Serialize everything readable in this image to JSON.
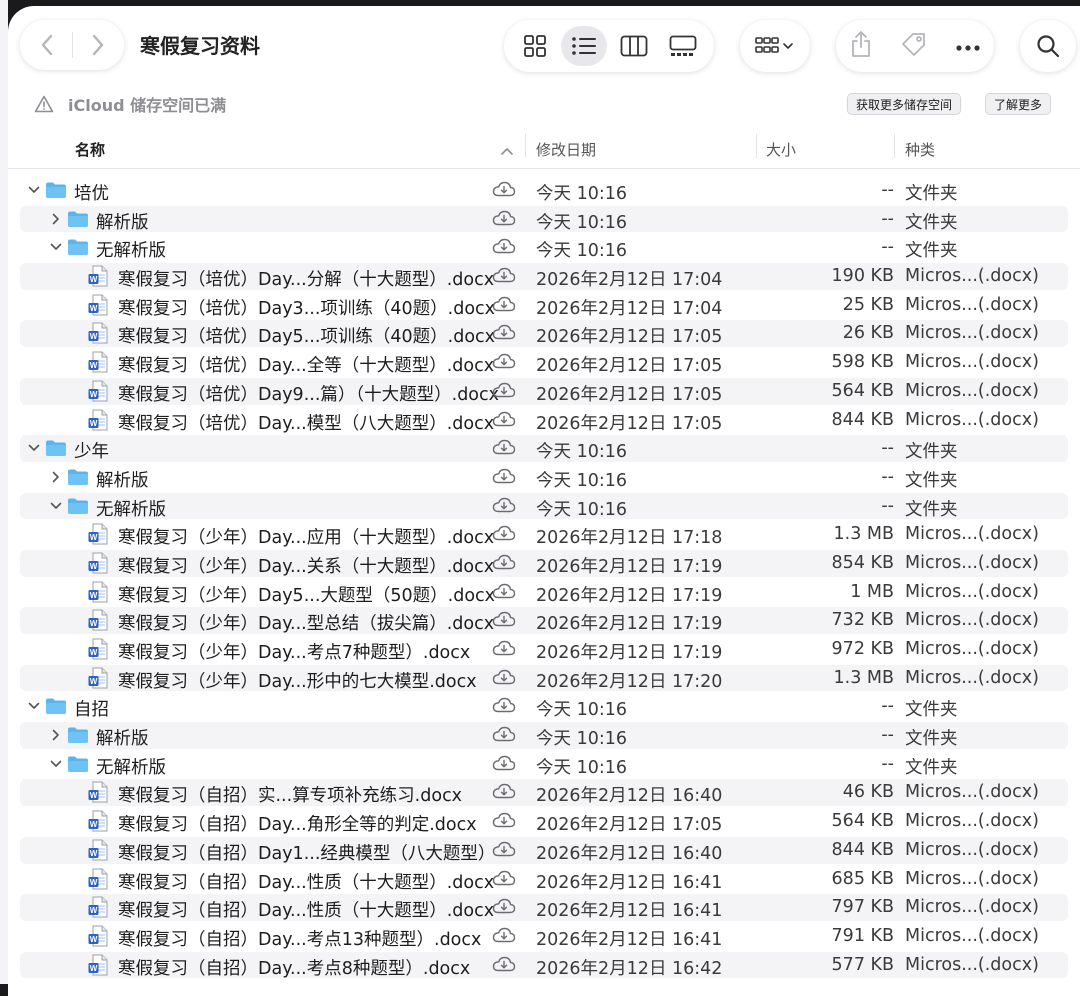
{
  "window": {
    "title": "寒假复习资料",
    "toolbar_icons": [
      "chevron-left-icon",
      "chevron-right-icon",
      "grid-view-icon",
      "list-view-icon",
      "column-view-icon",
      "gallery-view-icon",
      "group-icon",
      "share-icon",
      "tag-icon",
      "more-icon",
      "search-icon"
    ]
  },
  "notice": {
    "text": "iCloud 储存空间已满",
    "btn_more_storage": "获取更多储存空间",
    "btn_learn_more": "了解更多"
  },
  "columns": {
    "name": "名称",
    "date": "修改日期",
    "size": "大小",
    "kind": "种类"
  },
  "rows": [
    {
      "name": "培优",
      "date": "今天 10:16",
      "size": "--",
      "kind": "文件夹",
      "type": "folder",
      "level": 0,
      "disc": "open"
    },
    {
      "name": "解析版",
      "date": "今天 10:16",
      "size": "--",
      "kind": "文件夹",
      "type": "folder",
      "level": 1,
      "disc": "closed"
    },
    {
      "name": "无解析版",
      "date": "今天 10:16",
      "size": "--",
      "kind": "文件夹",
      "type": "folder",
      "level": 1,
      "disc": "open"
    },
    {
      "name": "寒假复习（培优）Day...分解（十大题型）.docx",
      "date": "2026年2月12日 17:04",
      "size": "190 KB",
      "kind": "Micros...(.docx)",
      "type": "doc",
      "level": 2
    },
    {
      "name": "寒假复习（培优）Day3...项训练（40题）.docx",
      "date": "2026年2月12日 17:04",
      "size": "25 KB",
      "kind": "Micros...(.docx)",
      "type": "doc",
      "level": 2
    },
    {
      "name": "寒假复习（培优）Day5...项训练（40题）.docx",
      "date": "2026年2月12日 17:05",
      "size": "26 KB",
      "kind": "Micros...(.docx)",
      "type": "doc",
      "level": 2
    },
    {
      "name": "寒假复习（培优）Day...全等（十大题型）.docx",
      "date": "2026年2月12日 17:05",
      "size": "598 KB",
      "kind": "Micros...(.docx)",
      "type": "doc",
      "level": 2
    },
    {
      "name": "寒假复习（培优）Day9...篇）（十大题型）.docx",
      "date": "2026年2月12日 17:05",
      "size": "564 KB",
      "kind": "Micros...(.docx)",
      "type": "doc",
      "level": 2
    },
    {
      "name": "寒假复习（培优）Day...模型（八大题型）.docx",
      "date": "2026年2月12日 17:05",
      "size": "844 KB",
      "kind": "Micros...(.docx)",
      "type": "doc",
      "level": 2
    },
    {
      "name": "少年",
      "date": "今天 10:16",
      "size": "--",
      "kind": "文件夹",
      "type": "folder",
      "level": 0,
      "disc": "open"
    },
    {
      "name": "解析版",
      "date": "今天 10:16",
      "size": "--",
      "kind": "文件夹",
      "type": "folder",
      "level": 1,
      "disc": "closed"
    },
    {
      "name": "无解析版",
      "date": "今天 10:16",
      "size": "--",
      "kind": "文件夹",
      "type": "folder",
      "level": 1,
      "disc": "open"
    },
    {
      "name": "寒假复习（少年）Day...应用（十大题型）.docx",
      "date": "2026年2月12日 17:18",
      "size": "1.3 MB",
      "kind": "Micros...(.docx)",
      "type": "doc",
      "level": 2
    },
    {
      "name": "寒假复习（少年）Day...关系（十大题型）.docx",
      "date": "2026年2月12日 17:19",
      "size": "854 KB",
      "kind": "Micros...(.docx)",
      "type": "doc",
      "level": 2
    },
    {
      "name": "寒假复习（少年）Day5...大题型（50题）.docx",
      "date": "2026年2月12日 17:19",
      "size": "1 MB",
      "kind": "Micros...(.docx)",
      "type": "doc",
      "level": 2
    },
    {
      "name": "寒假复习（少年）Day...型总结（拔尖篇）.docx",
      "date": "2026年2月12日 17:19",
      "size": "732 KB",
      "kind": "Micros...(.docx)",
      "type": "doc",
      "level": 2
    },
    {
      "name": "寒假复习（少年）Day...考点7种题型）.docx",
      "date": "2026年2月12日 17:19",
      "size": "972 KB",
      "kind": "Micros...(.docx)",
      "type": "doc",
      "level": 2
    },
    {
      "name": "寒假复习（少年）Day...形中的七大模型.docx",
      "date": "2026年2月12日 17:20",
      "size": "1.3 MB",
      "kind": "Micros...(.docx)",
      "type": "doc",
      "level": 2
    },
    {
      "name": "自招",
      "date": "今天 10:16",
      "size": "--",
      "kind": "文件夹",
      "type": "folder",
      "level": 0,
      "disc": "open"
    },
    {
      "name": "解析版",
      "date": "今天 10:16",
      "size": "--",
      "kind": "文件夹",
      "type": "folder",
      "level": 1,
      "disc": "closed"
    },
    {
      "name": "无解析版",
      "date": "今天 10:16",
      "size": "--",
      "kind": "文件夹",
      "type": "folder",
      "level": 1,
      "disc": "open"
    },
    {
      "name": "寒假复习（自招）实...算专项补充练习.docx",
      "date": "2026年2月12日 16:40",
      "size": "46 KB",
      "kind": "Micros...(.docx)",
      "type": "doc",
      "level": 2
    },
    {
      "name": "寒假复习（自招）Day...角形全等的判定.docx",
      "date": "2026年2月12日 17:05",
      "size": "564 KB",
      "kind": "Micros...(.docx)",
      "type": "doc",
      "level": 2
    },
    {
      "name": "寒假复习（自招）Day1...经典模型（八大题型）",
      "date": "2026年2月12日 16:40",
      "size": "844 KB",
      "kind": "Micros...(.docx)",
      "type": "doc",
      "level": 2
    },
    {
      "name": "寒假复习（自招）Day...性质（十大题型）.docx",
      "date": "2026年2月12日 16:41",
      "size": "685 KB",
      "kind": "Micros...(.docx)",
      "type": "doc",
      "level": 2
    },
    {
      "name": "寒假复习（自招）Day...性质（十大题型）.docx",
      "date": "2026年2月12日 16:41",
      "size": "797 KB",
      "kind": "Micros...(.docx)",
      "type": "doc",
      "level": 2
    },
    {
      "name": "寒假复习（自招）Day...考点13种题型）.docx",
      "date": "2026年2月12日 16:41",
      "size": "791 KB",
      "kind": "Micros...(.docx)",
      "type": "doc",
      "level": 2
    },
    {
      "name": "寒假复习（自招）Day...考点8种题型）.docx",
      "date": "2026年2月12日 16:42",
      "size": "577 KB",
      "kind": "Micros...(.docx)",
      "type": "doc",
      "level": 2
    }
  ]
}
